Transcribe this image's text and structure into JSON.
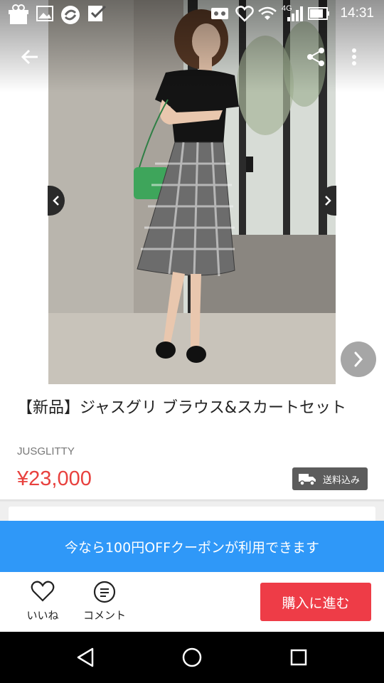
{
  "status_bar": {
    "time": "14:31",
    "network": "4G",
    "icons": [
      "gift-box-icon",
      "image-icon",
      "sync-icon",
      "checklist-icon",
      "vr-icon",
      "heart-notification-icon",
      "wifi-icon",
      "signal-icon",
      "battery-icon"
    ]
  },
  "app_bar": {
    "icons": [
      "arrow-back-icon",
      "share-icon",
      "more-vert-icon"
    ]
  },
  "gallery": {
    "icons": [
      "chevron-left-icon",
      "chevron-right-icon",
      "next-arrow-icon"
    ]
  },
  "product": {
    "title": "【新品】ジャスグリ ブラウス&スカートセット",
    "brand": "JUSGLITTY",
    "price": "¥23,000",
    "price_color": "#e8413e",
    "shipping_label": "送料込み"
  },
  "coupon": {
    "text": "今なら100円OFFクーポンが利用できます",
    "color": "#2f98f8"
  },
  "actions": {
    "like_label": "いいね",
    "comment_label": "コメント",
    "buy_label": "購入に進む",
    "buy_color": "#ee3c47"
  },
  "nav": {
    "icons": [
      "back-triangle-icon",
      "home-circle-icon",
      "recents-square-icon"
    ]
  }
}
